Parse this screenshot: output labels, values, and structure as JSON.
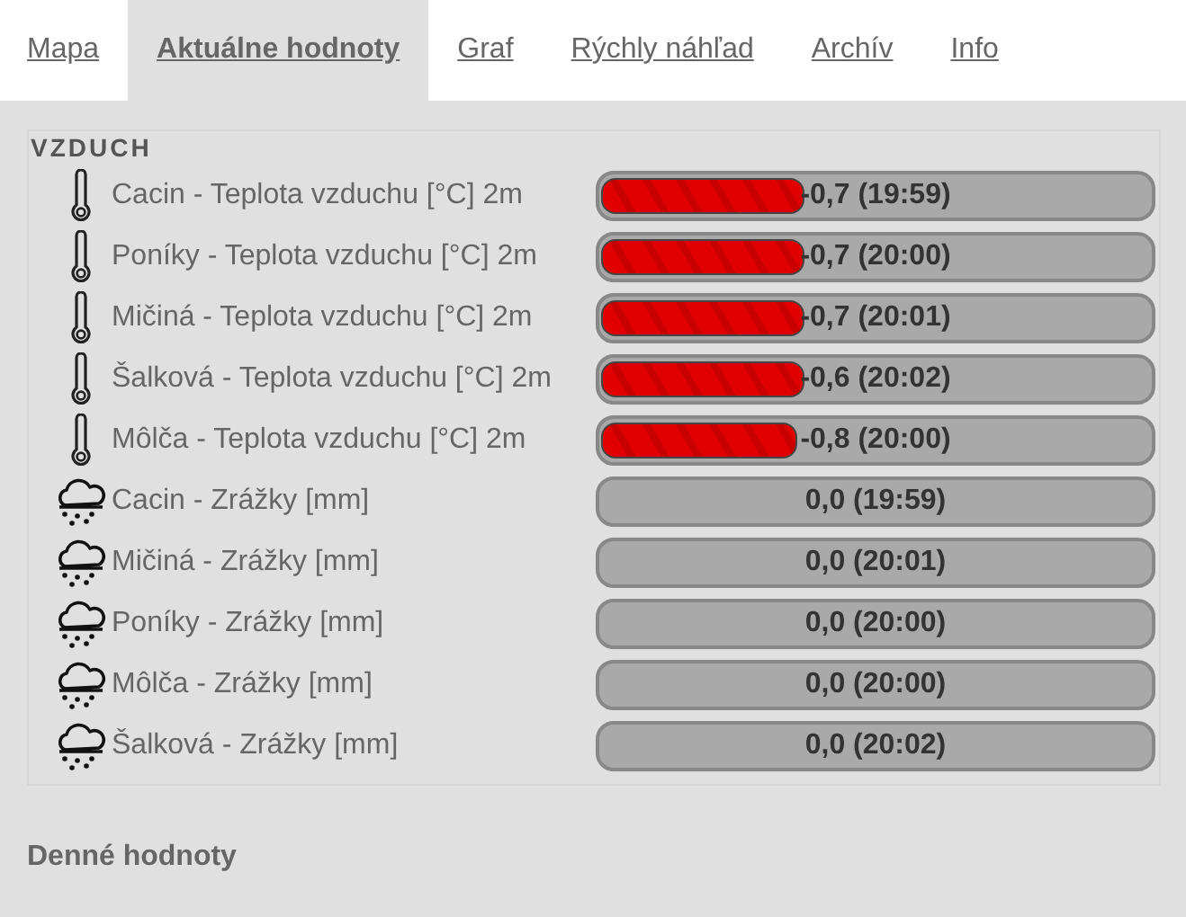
{
  "tabs": [
    {
      "label": "Mapa",
      "selected": false
    },
    {
      "label": "Aktuálne hodnoty",
      "selected": true
    },
    {
      "label": "Graf",
      "selected": false
    },
    {
      "label": "Rýchly náhľad",
      "selected": false
    },
    {
      "label": "Archív",
      "selected": false
    },
    {
      "label": "Info",
      "selected": false
    }
  ],
  "section": {
    "title": "VZDUCH",
    "rows": [
      {
        "kind": "temperature",
        "label": "Cacin - Teplota vzduchu [°C] 2m",
        "level": 0.36,
        "reading": "-0,7 (19:59)"
      },
      {
        "kind": "temperature",
        "label": "Poníky - Teplota vzduchu [°C] 2m",
        "level": 0.36,
        "reading": "-0,7 (20:00)"
      },
      {
        "kind": "temperature",
        "label": "Mičiná - Teplota vzduchu [°C] 2m",
        "level": 0.36,
        "reading": "-0,7 (20:01)"
      },
      {
        "kind": "temperature",
        "label": "Šalková - Teplota vzduchu [°C] 2m",
        "level": 0.36,
        "reading": "-0,6 (20:02)"
      },
      {
        "kind": "temperature",
        "label": "Môlča - Teplota vzduchu [°C] 2m",
        "level": 0.35,
        "reading": "-0,8 (20:00)"
      },
      {
        "kind": "precipitation",
        "label": "Cacin - Zrážky [mm]",
        "reading": "0,0 (19:59)"
      },
      {
        "kind": "precipitation",
        "label": "Mičiná - Zrážky [mm]",
        "reading": "0,0 (20:01)"
      },
      {
        "kind": "precipitation",
        "label": "Poníky - Zrážky [mm]",
        "reading": "0,0 (20:00)"
      },
      {
        "kind": "precipitation",
        "label": "Môlča - Zrážky [mm]",
        "reading": "0,0 (20:00)"
      },
      {
        "kind": "precipitation",
        "label": "Šalková - Zrážky [mm]",
        "reading": "0,0 (20:02)"
      }
    ]
  },
  "footer_heading": "Denné hodnoty"
}
